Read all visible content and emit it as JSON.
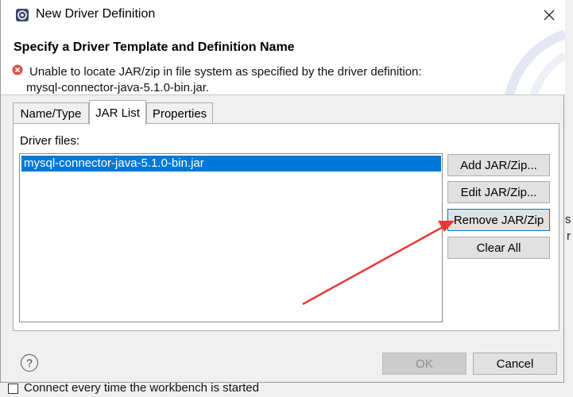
{
  "background": {
    "side_texts": [
      "s",
      "r"
    ],
    "checkbox_label": "Connect every time the workbench is started"
  },
  "dialog": {
    "title": "New Driver Definition",
    "heading": "Specify a Driver Template and Definition Name",
    "error_line1": "Unable to locate JAR/zip in file system as specified by the driver definition:",
    "error_line2": "mysql-connector-java-5.1.0-bin.jar.",
    "tabs": [
      {
        "label": "Name/Type",
        "active": false
      },
      {
        "label": "JAR List",
        "active": true
      },
      {
        "label": "Properties",
        "active": false
      }
    ],
    "driver_files_label": "Driver files:",
    "driver_files": [
      "mysql-connector-java-5.1.0-bin.jar"
    ],
    "side_buttons": {
      "add": "Add JAR/Zip...",
      "edit": "Edit JAR/Zip...",
      "remove": "Remove JAR/Zip",
      "clear": "Clear All"
    },
    "help_symbol": "?",
    "ok_label": "OK",
    "cancel_label": "Cancel"
  },
  "colors": {
    "selection": "#0078d7",
    "error": "#d9534f",
    "annotation_arrow": "#e53935"
  },
  "icons": [
    "app-icon",
    "close-icon",
    "error-icon",
    "help-icon"
  ]
}
